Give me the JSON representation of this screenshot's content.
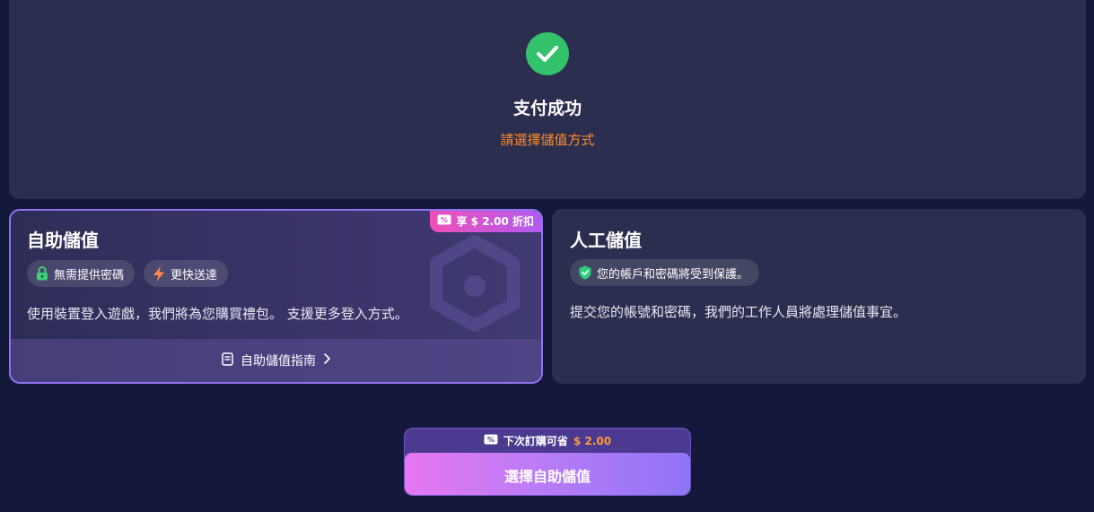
{
  "success": {
    "title": "支付成功",
    "subtitle": "請選擇儲值方式",
    "icon": "check-circle-icon",
    "color": "#33c26b"
  },
  "self_topup": {
    "title": "自助儲值",
    "badge": "享 $ 2.00 折扣",
    "tags": [
      {
        "label": "無需提供密碼",
        "icon": "lock-icon"
      },
      {
        "label": "更快送達",
        "icon": "lightning-icon"
      }
    ],
    "description": "使用裝置登入遊戲，我們將為您購買禮包。 支援更多登入方式。",
    "guide_label": "自助儲值指南",
    "selected": true
  },
  "manual_topup": {
    "title": "人工儲值",
    "tags": [
      {
        "label": "您的帳戶和密碼將受到保護。",
        "icon": "shield-check-icon"
      }
    ],
    "description": "提交您的帳號和密碼，我們的工作人員將處理儲值事宜。"
  },
  "cta": {
    "note_prefix": "下次訂購可省",
    "note_amount": "$ 2.00",
    "button_label": "選擇自助儲值"
  },
  "colors": {
    "background": "#14183a",
    "accent_orange": "#ff8a2a",
    "accent_purple": "#8e74f2"
  }
}
